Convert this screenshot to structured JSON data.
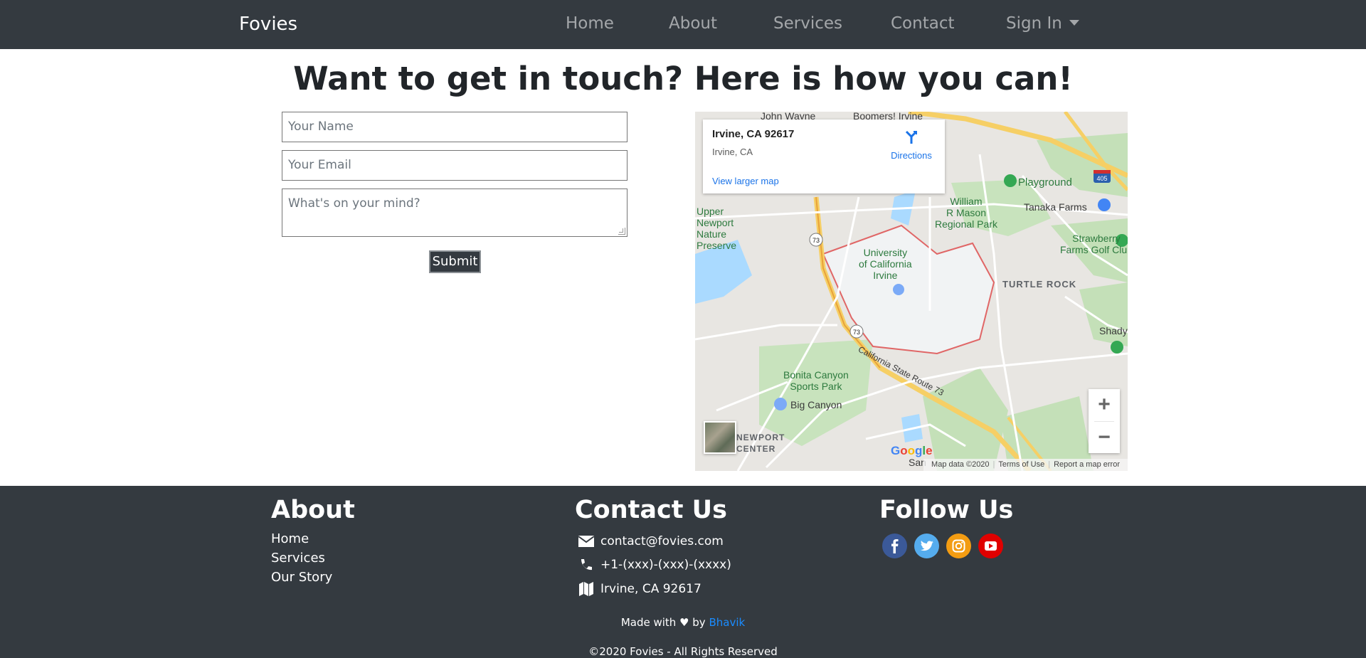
{
  "navbar": {
    "brand": "Fovies",
    "links": [
      "Home",
      "About",
      "Services",
      "Contact"
    ],
    "dropdown": "Sign In"
  },
  "heading": "Want to get in touch? Here is how you can!",
  "form": {
    "name_placeholder": "Your Name",
    "email_placeholder": "Your Email",
    "message_placeholder": "What's on your mind?",
    "submit_label": "Submit"
  },
  "map": {
    "info_title": "Irvine, CA 92617",
    "info_subtitle": "Irvine, CA",
    "directions_label": "Directions",
    "larger_map_label": "View larger map",
    "labels": {
      "john_wayne": "John Wayne",
      "boomers": "Boomers! Irvine",
      "playground": "Playground",
      "william": "William\nR Mason\nRegional Park",
      "tanaka": "Tanaka Farms",
      "strawberry": "Strawberry\nFarms Golf Club",
      "upper": "Upper\nNewport\nNature\nPreserve",
      "uci": "University\nof California\nIrvine",
      "turtle_rock": "TURTLE ROCK",
      "shady": "Shady",
      "bonita": "Bonita Canyon\nSports Park",
      "big_canyon": "Big Canyon",
      "newport_center": "NEWPORT\nCENTER",
      "route": "California State Route 73",
      "san": "San"
    },
    "shields": [
      "73",
      "73",
      "405"
    ],
    "zoom_in": "+",
    "zoom_out": "−",
    "google": "Google",
    "footer": [
      "Map data ©2020",
      "Terms of Use",
      "Report a map error"
    ]
  },
  "footer": {
    "about_title": "About",
    "about_links": [
      "Home",
      "Services",
      "Our Story"
    ],
    "contact_title": "Contact Us",
    "email": "contact@fovies.com",
    "phone": "+1-(xxx)-(xxx)-(xxxx)",
    "address": "Irvine, CA 92617",
    "follow_title": "Follow Us",
    "social": [
      {
        "name": "facebook-icon",
        "color": "#3b5998"
      },
      {
        "name": "twitter-icon",
        "color": "#55acee"
      },
      {
        "name": "instagram-icon",
        "color": "#f39c12"
      },
      {
        "name": "youtube-icon",
        "color": "#e00000"
      }
    ],
    "made_prefix": "Made with ♥ by",
    "made_author": "Bhavik",
    "copyright": "©2020 Fovies - All Rights Reserved"
  },
  "colors": {
    "navbar_bg": "#343a40",
    "link_accent": "#1a8cff",
    "map_link": "#1a73e8"
  }
}
